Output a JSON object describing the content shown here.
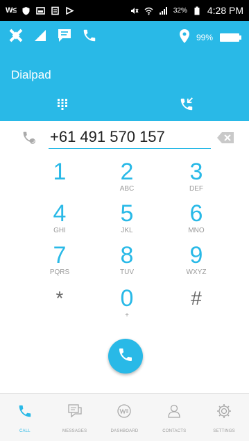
{
  "status_bar": {
    "carrier_logo": "W≤",
    "signal_percent": "32%",
    "time": "4:28 PM",
    "icons": [
      "shield-icon",
      "image-icon",
      "clipboard-icon",
      "play-icon",
      "mute-icon",
      "wifi-icon",
      "signal-icon",
      "battery-icon"
    ]
  },
  "header": {
    "battery_text": "99%",
    "title": "Dialpad",
    "icons": [
      "satellite-icon",
      "signal-icon",
      "message-icon",
      "phone-icon",
      "location-pin-icon",
      "battery-icon"
    ],
    "tabs": [
      {
        "name": "dialpad-tab",
        "icon": "keypad-icon",
        "active": true
      },
      {
        "name": "call-log-tab",
        "icon": "call-log-icon",
        "active": false
      }
    ]
  },
  "dialer": {
    "number": "+61 491 570 157",
    "keys": [
      {
        "digit": "1",
        "letters": ""
      },
      {
        "digit": "2",
        "letters": "ABC"
      },
      {
        "digit": "3",
        "letters": "DEF"
      },
      {
        "digit": "4",
        "letters": "GHI"
      },
      {
        "digit": "5",
        "letters": "JKL"
      },
      {
        "digit": "6",
        "letters": "MNO"
      },
      {
        "digit": "7",
        "letters": "PQRS"
      },
      {
        "digit": "8",
        "letters": "TUV"
      },
      {
        "digit": "9",
        "letters": "WXYZ"
      },
      {
        "digit": "*",
        "letters": ""
      },
      {
        "digit": "0",
        "letters": "+"
      },
      {
        "digit": "#",
        "letters": ""
      }
    ]
  },
  "bottom_nav": {
    "items": [
      {
        "label": "CALL",
        "icon": "phone-icon",
        "active": true
      },
      {
        "label": "MESSAGES",
        "icon": "messages-icon",
        "active": false
      },
      {
        "label": "DASHBOARD",
        "icon": "dashboard-icon",
        "active": false
      },
      {
        "label": "CONTACTS",
        "icon": "contacts-icon",
        "active": false
      },
      {
        "label": "SETTINGS",
        "icon": "gear-icon",
        "active": false
      }
    ]
  },
  "colors": {
    "accent": "#29b9e7",
    "status_bar": "#000000",
    "key_letters": "#999999"
  }
}
